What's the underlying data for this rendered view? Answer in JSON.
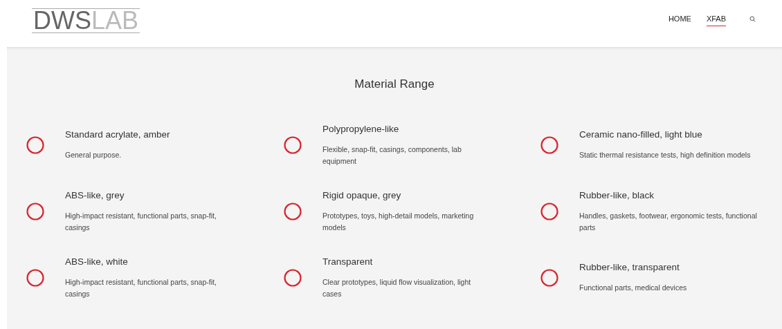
{
  "header": {
    "logo": {
      "strong": "DWS",
      "light": "LAB"
    },
    "nav": [
      {
        "label": "HOME",
        "selected": false
      },
      {
        "label": "XFAB",
        "selected": true
      }
    ]
  },
  "section": {
    "title": "Material Range",
    "rows": [
      [
        {
          "name": "Standard acrylate, amber",
          "description": "General purpose."
        },
        {
          "name": "Polypropylene-like",
          "description": "Flexible, snap-fit, casings, components, lab equipment"
        },
        {
          "name": "Ceramic nano-filled, light blue",
          "description": "Static thermal resistance tests, high definition models"
        }
      ],
      [
        {
          "name": "ABS-like, grey",
          "description": "High-impact resistant, functional parts, snap-fit, casings"
        },
        {
          "name": "Rigid opaque, grey",
          "description": "Prototypes, toys, high-detail models, marketing models"
        },
        {
          "name": "Rubber-like, black",
          "description": "Handles, gaskets, footwear, ergonomic tests, functional parts"
        }
      ],
      [
        {
          "name": "ABS-like, white",
          "description": "High-impact resistant, functional parts, snap-fit, casings"
        },
        {
          "name": "Transparent",
          "description": "Clear prototypes, liquid flow visualization, light cases"
        },
        {
          "name": "Rubber-like, transparent",
          "description": "Functional parts, medical devices"
        }
      ]
    ]
  }
}
